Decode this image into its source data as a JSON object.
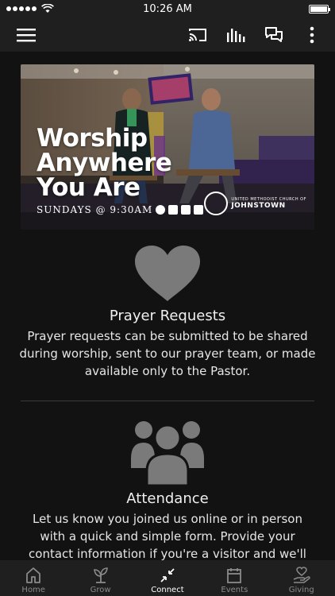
{
  "status_bar": {
    "time": "10:26 AM"
  },
  "hero": {
    "title_lines": [
      "Worship",
      "Anywhere",
      "You Are"
    ],
    "subtitle": "SUNDAYS @ 9:30AM",
    "church_small": "UNITED METHODIST CHURCH OF",
    "church_name": "JOHNSTOWN"
  },
  "prayer": {
    "title": "Prayer Requests",
    "body": "Prayer requests can be submitted to be shared during worship, sent to our prayer team, or made available only to the Pastor."
  },
  "attendance": {
    "title": "Attendance",
    "body": "Let us know you joined us online or in person with a quick and simple form. Provide your contact information if you're a visitor and we'll"
  },
  "tabs": [
    {
      "label": "Home",
      "icon": "home-icon"
    },
    {
      "label": "Grow",
      "icon": "plant-icon"
    },
    {
      "label": "Connect",
      "icon": "connect-arrows-icon",
      "active": true
    },
    {
      "label": "Events",
      "icon": "calendar-icon"
    },
    {
      "label": "Giving",
      "icon": "giving-hand-icon"
    }
  ],
  "app_bar_icons": [
    "menu-icon",
    "cast-icon",
    "audio-bars-icon",
    "chat-icon",
    "more-vertical-icon"
  ],
  "colors": {
    "background": "#121212",
    "bar": "#1f1f1f",
    "icon_gray": "#7a7a7a",
    "tab_inactive": "#8a8a8a"
  }
}
